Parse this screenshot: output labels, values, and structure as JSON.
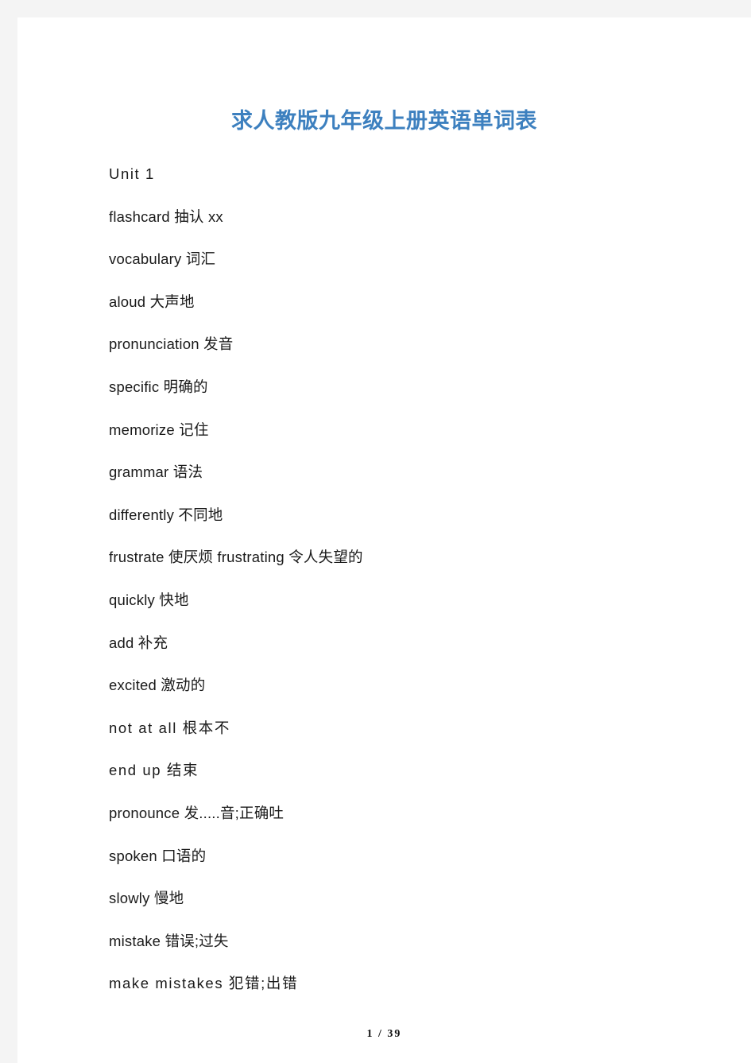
{
  "document": {
    "title": "求人教版九年级上册英语单词表",
    "title_color": "#3d80bf",
    "page_background": "#ffffff",
    "surround_color": "#f4f4f4"
  },
  "entries": [
    {
      "text": "Unit  1",
      "spaced": true
    },
    {
      "text": "flashcard 抽认 xx",
      "spaced": false
    },
    {
      "text": "vocabulary 词汇",
      "spaced": false
    },
    {
      "text": "aloud 大声地",
      "spaced": false
    },
    {
      "text": "pronunciation 发音",
      "spaced": false
    },
    {
      "text": "specific 明确的",
      "spaced": false
    },
    {
      "text": "memorize 记住",
      "spaced": false
    },
    {
      "text": "grammar 语法",
      "spaced": false
    },
    {
      "text": "differently 不同地",
      "spaced": false
    },
    {
      "text": "frustrate 使厌烦 frustrating 令人失望的",
      "spaced": false
    },
    {
      "text": "quickly 快地",
      "spaced": false
    },
    {
      "text": "add 补充",
      "spaced": false
    },
    {
      "text": "excited 激动的",
      "spaced": false
    },
    {
      "text": "not  at  all 根本不",
      "spaced": true
    },
    {
      "text": "end  up 结束",
      "spaced": true
    },
    {
      "text": "pronounce 发.....音;正确吐",
      "spaced": false
    },
    {
      "text": "spoken 口语的",
      "spaced": false
    },
    {
      "text": "slowly 慢地",
      "spaced": false
    },
    {
      "text": "mistake 错误;过失",
      "spaced": false
    },
    {
      "text": "make  mistakes 犯错;出错",
      "spaced": true
    }
  ],
  "footer": {
    "page_indicator": "1 / 39",
    "current_page": "1",
    "total_pages": "39"
  }
}
